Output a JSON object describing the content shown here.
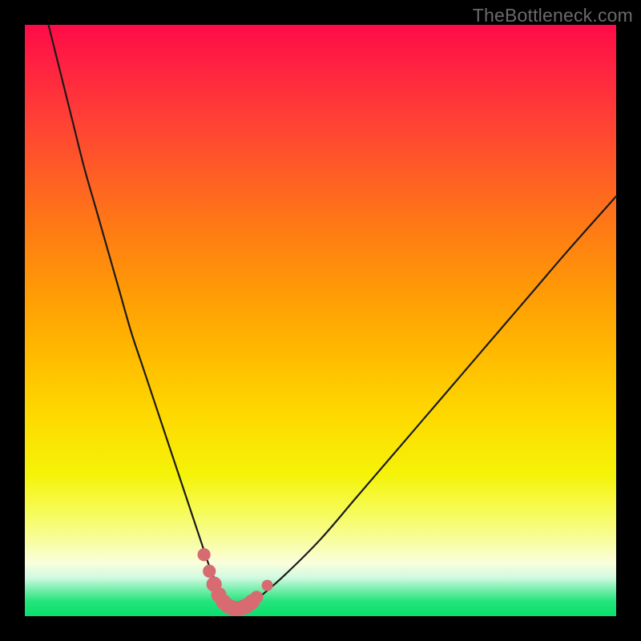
{
  "watermark": "TheBottleneck.com",
  "colors": {
    "frame": "#000000",
    "curve_stroke": "#1a1a1a",
    "marker_fill": "#d86b72",
    "marker_stroke": "#d86b72"
  },
  "chart_data": {
    "type": "line",
    "title": "",
    "xlabel": "",
    "ylabel": "",
    "xlim": [
      0,
      100
    ],
    "ylim": [
      0,
      100
    ],
    "grid": false,
    "legend": false,
    "series": [
      {
        "name": "bottleneck-curve",
        "x": [
          4,
          6,
          8,
          10,
          12,
          14,
          16,
          18,
          20,
          22,
          24,
          26,
          28,
          30,
          31,
          32,
          33,
          34,
          35,
          36,
          37,
          38,
          40,
          44,
          50,
          56,
          62,
          68,
          74,
          80,
          86,
          92,
          100
        ],
        "y": [
          100,
          92,
          84,
          76,
          69,
          62,
          55,
          48,
          42,
          36,
          30,
          24,
          18,
          12,
          9,
          6.5,
          4.5,
          3,
          2,
          1.5,
          1.5,
          2,
          3.5,
          7,
          13,
          20,
          27,
          34,
          41,
          48,
          55,
          62,
          71
        ]
      }
    ],
    "markers": [
      {
        "x": 30.3,
        "y": 10.4,
        "r": 1.1
      },
      {
        "x": 31.2,
        "y": 7.6,
        "r": 1.1
      },
      {
        "x": 32.0,
        "y": 5.4,
        "r": 1.3
      },
      {
        "x": 32.8,
        "y": 3.6,
        "r": 1.3
      },
      {
        "x": 33.6,
        "y": 2.4,
        "r": 1.3
      },
      {
        "x": 34.4,
        "y": 1.7,
        "r": 1.3
      },
      {
        "x": 35.2,
        "y": 1.35,
        "r": 1.3
      },
      {
        "x": 36.0,
        "y": 1.3,
        "r": 1.3
      },
      {
        "x": 36.8,
        "y": 1.45,
        "r": 1.3
      },
      {
        "x": 37.6,
        "y": 1.8,
        "r": 1.3
      },
      {
        "x": 38.4,
        "y": 2.4,
        "r": 1.3
      },
      {
        "x": 39.2,
        "y": 3.2,
        "r": 1.1
      },
      {
        "x": 41.0,
        "y": 5.2,
        "r": 0.95
      }
    ]
  }
}
